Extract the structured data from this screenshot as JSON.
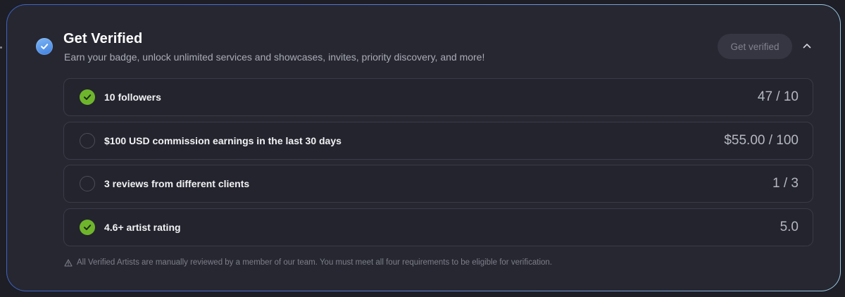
{
  "header": {
    "title": "Get Verified",
    "subtitle": "Earn your badge, unlock unlimited services and showcases, invites, priority discovery, and more!",
    "button_label": "Get verified",
    "badge_icon": "verified-check-icon",
    "collapse_icon": "chevron-up-icon"
  },
  "requirements": [
    {
      "label": "10 followers",
      "value": "47 / 10",
      "complete": true
    },
    {
      "label": "$100 USD commission earnings in the last 30 days",
      "value": "$55.00 / 100",
      "complete": false
    },
    {
      "label": "3 reviews from different clients",
      "value": "1 / 3",
      "complete": false
    },
    {
      "label": "4.6+ artist rating",
      "value": "5.0",
      "complete": true
    }
  ],
  "disclaimer": {
    "icon": "warning-icon",
    "text": "All Verified Artists are manually reviewed by a member of our team. You must meet all four requirements to be eligible for verification."
  },
  "colors": {
    "background": "#1d1e26",
    "card": "#262731",
    "complete": "#6fb52c",
    "accent_blue": "#3e7fe0"
  }
}
